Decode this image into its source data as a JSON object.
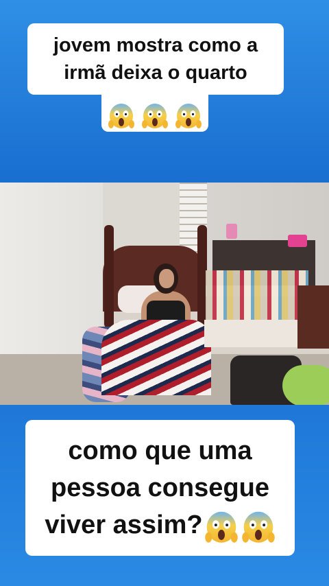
{
  "top_caption": {
    "line1": "jovem mostra como a",
    "line2": "irmã deixa o quarto",
    "emojis": [
      "face-screaming-in-fear",
      "face-screaming-in-fear",
      "face-screaming-in-fear"
    ]
  },
  "video": {
    "description_icon": "bedroom-video-frame"
  },
  "bottom_caption": {
    "line1": "como que uma",
    "line2": "pessoa consegue",
    "line3": "viver assim?",
    "emojis": [
      "face-screaming-in-fear",
      "face-screaming-in-fear"
    ]
  },
  "colors": {
    "background_top": "#2f8fe6",
    "background_mid": "#1a6fd0",
    "caption_bg": "#ffffff",
    "caption_text": "#111111",
    "emoji_face": "#f7c948",
    "emoji_face_top": "#5aa9e6"
  }
}
